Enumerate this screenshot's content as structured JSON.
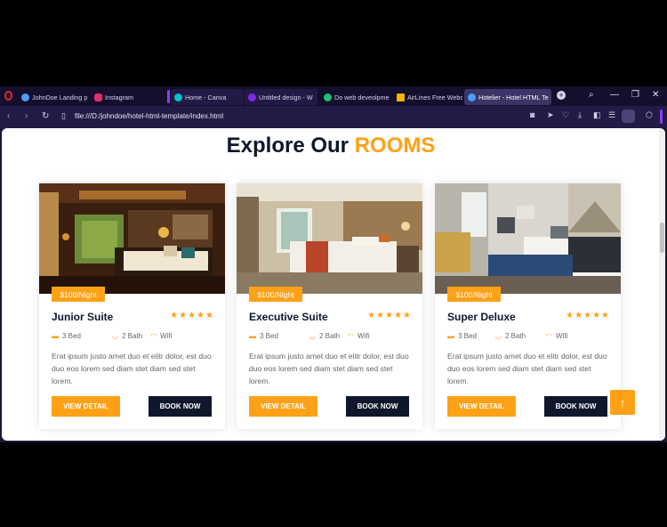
{
  "browser": {
    "tabs": [
      {
        "label": "JohnDoe Landing p",
        "color": "#4a9df8"
      },
      {
        "label": "Instagram",
        "color": "#e1306c"
      },
      {
        "label": "Home - Canva",
        "color": "#00c4cc"
      },
      {
        "label": "Untitled design - W",
        "color": "#7d2ae8"
      },
      {
        "label": "Do web deveolpme",
        "color": "#1dbf73"
      },
      {
        "label": "AirLines Free Websi",
        "color": "#f4b400"
      },
      {
        "label": "Hotelier - Hotel HTML Te",
        "color": "#4a9df8"
      }
    ],
    "url": "file:///D:/johndoe/hotel-html-template/index.html"
  },
  "section": {
    "title_main": "Explore Our",
    "title_accent": "ROOMS"
  },
  "rooms": [
    {
      "price": "$100/Night",
      "name": "Junior Suite",
      "stars": "★★★★★",
      "beds": "3 Bed",
      "baths": "2 Bath",
      "wifi": "Wifi",
      "description": "Erat ipsum justo amet duo et elitr dolor, est duo duo eos lorem sed diam stet diam sed stet lorem.",
      "detail_label": "VIEW DETAIL",
      "book_label": "BOOK NOW"
    },
    {
      "price": "$100/Night",
      "name": "Executive Suite",
      "stars": "★★★★★",
      "beds": "3 Bed",
      "baths": "2 Bath",
      "wifi": "Wifi",
      "description": "Erat ipsum justo amet duo et elitr dolor, est duo duo eos lorem sed diam stet diam sed stet lorem.",
      "detail_label": "VIEW DETAIL",
      "book_label": "BOOK NOW"
    },
    {
      "price": "$100/Night",
      "name": "Super Deluxe",
      "stars": "★★★★★",
      "beds": "3 Bed",
      "baths": "2 Bath",
      "wifi": "Wifi",
      "description": "Erat ipsum justo amet duo et elitr dolor, est duo duo eos lorem sed diam stet diam sed stet lorem.",
      "detail_label": "VIEW DETAIL",
      "book_label": "BOOK NOW"
    }
  ],
  "back_to_top_icon": "arrow-up-icon",
  "colors": {
    "accent": "#fea116",
    "dark": "#0f172b"
  }
}
